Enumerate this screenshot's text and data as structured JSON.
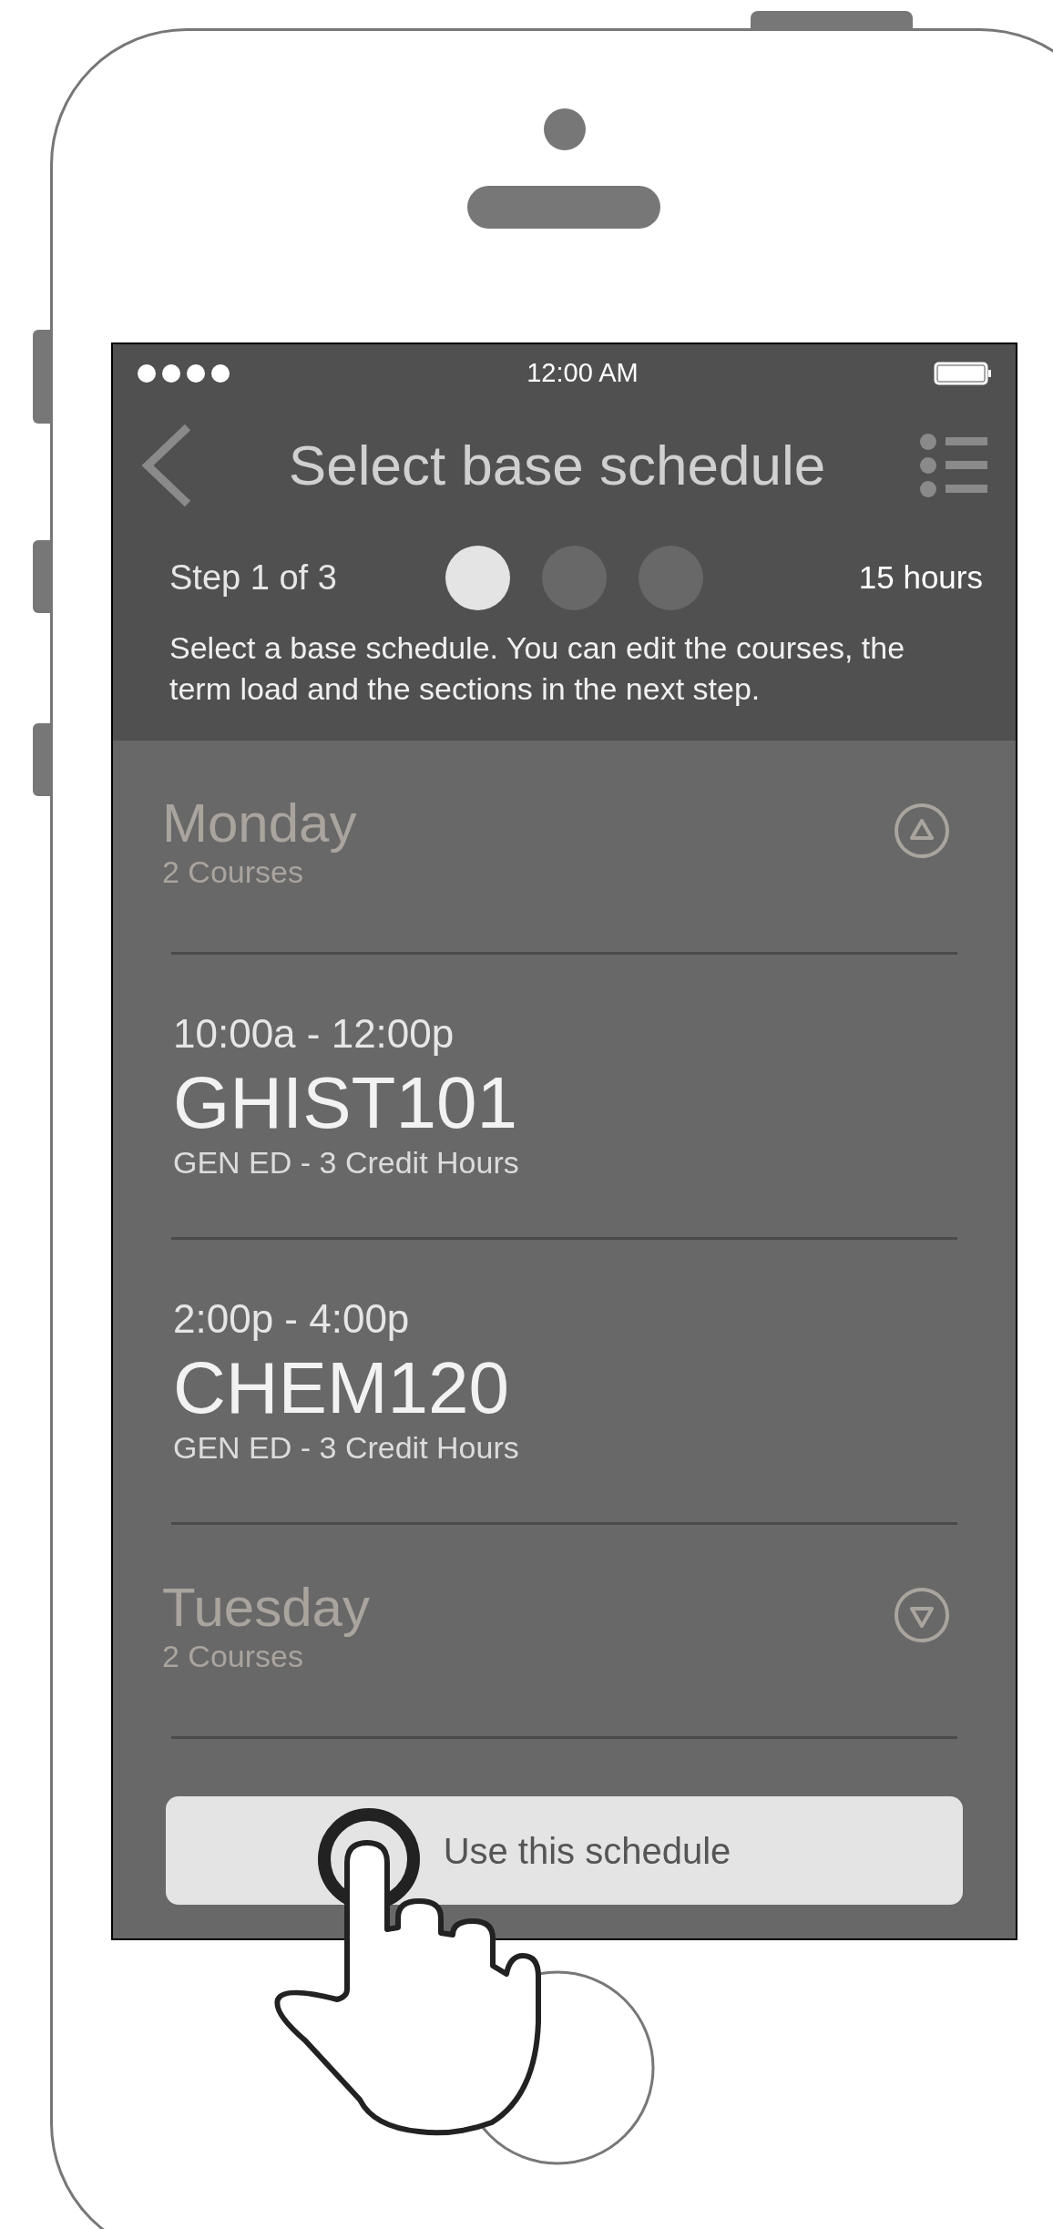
{
  "status_bar": {
    "time": "12:00 AM"
  },
  "nav": {
    "title": "Select base schedule"
  },
  "progress": {
    "label": "Step 1 of 3",
    "steps": [
      {
        "selected": true
      },
      {
        "selected": false
      },
      {
        "selected": false
      }
    ],
    "total": "15 hours"
  },
  "description": "Select a base schedule. You can edit the courses, the term load and the sections in the next step.",
  "days": [
    {
      "name": "Monday",
      "count": "2 Courses",
      "expanded": true,
      "courses": [
        {
          "time": "10:00a - 12:00p",
          "code": "GHIST101",
          "detail": "GEN ED - 3 Credit Hours"
        },
        {
          "time": "2:00p - 4:00p",
          "code": "CHEM120",
          "detail": "GEN ED - 3 Credit Hours"
        }
      ]
    },
    {
      "name": "Tuesday",
      "count": "2 Courses",
      "expanded": false
    }
  ],
  "action_button": {
    "label": "Use this schedule"
  }
}
